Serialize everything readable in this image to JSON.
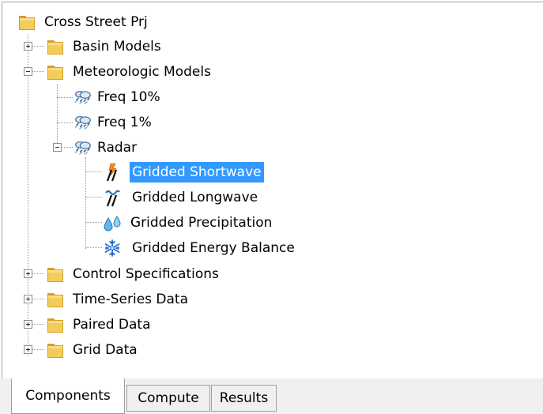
{
  "tree": {
    "root": "Cross Street Prj",
    "basin_models": "Basin Models",
    "meteorologic_models": "Meteorologic Models",
    "freq_10": "Freq 10%",
    "freq_1": "Freq 1%",
    "radar": "Radar",
    "gridded_shortwave": "Gridded Shortwave",
    "gridded_longwave": "Gridded Longwave",
    "gridded_precipitation": "Gridded Precipitation",
    "gridded_energy_balance": "Gridded Energy Balance",
    "control_specifications": "Control Specifications",
    "time_series_data": "Time-Series Data",
    "paired_data": "Paired Data",
    "grid_data": "Grid Data"
  },
  "tabs": {
    "components": "Components",
    "compute": "Compute",
    "results": "Results"
  },
  "colors": {
    "selection": "#3399ff",
    "folder": "#e8b93c"
  }
}
